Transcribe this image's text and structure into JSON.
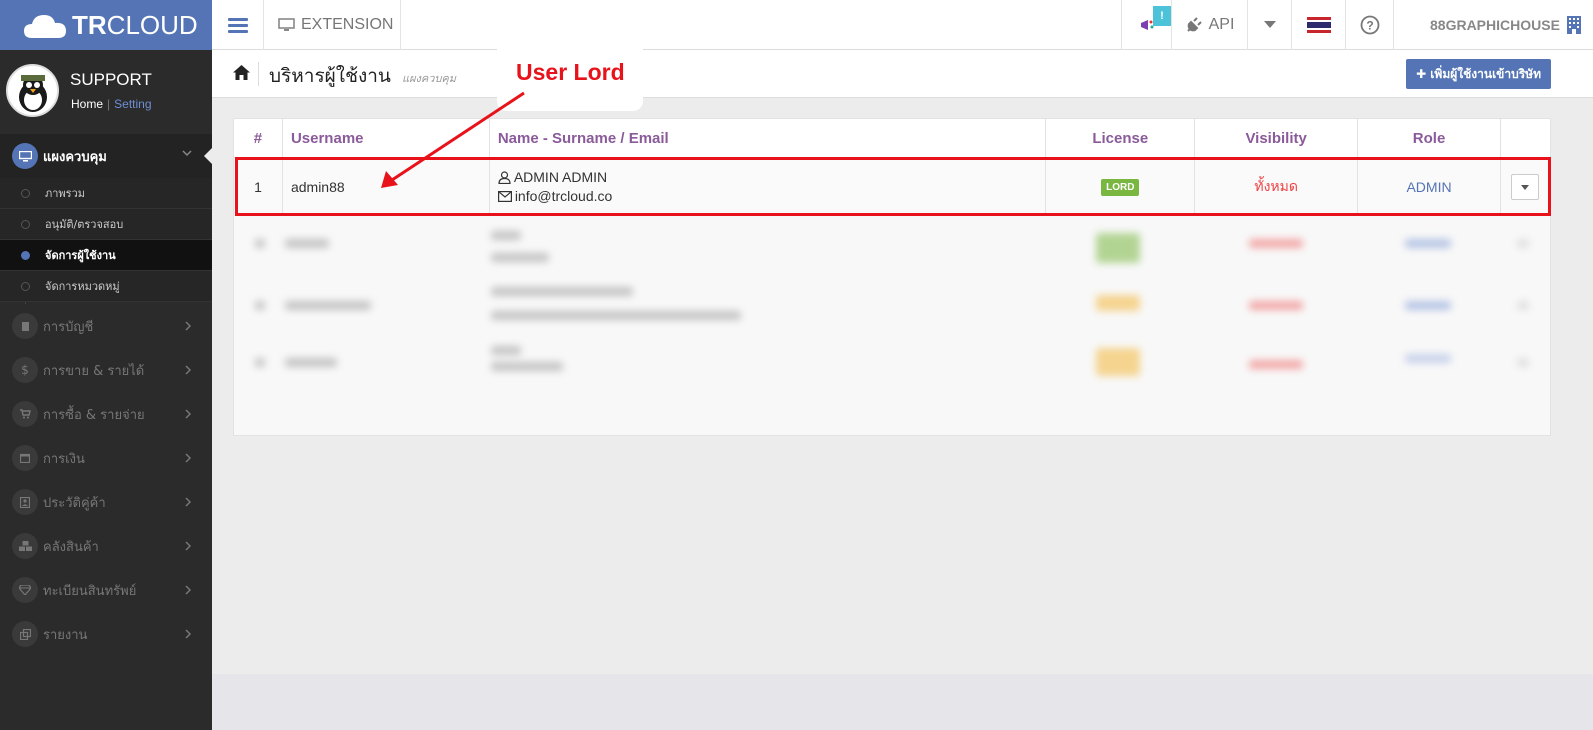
{
  "topbar": {
    "brand_bold": "TR",
    "brand_light": "CLOUD",
    "extension_label": "EXTENSION",
    "notification_badge": "!",
    "api_label": "API",
    "user_label": "88GRAPHICHOUSE",
    "icons": [
      "cloud-icon",
      "menu-icon",
      "monitor-icon",
      "megaphone-icon",
      "plug-icon",
      "caret-down-icon",
      "thai-flag-icon",
      "help-icon",
      "building-icon"
    ]
  },
  "sidebar": {
    "profile_name": "SUPPORT",
    "home_link": "Home",
    "setting_link": "Setting",
    "main_item": "แผงควบคุม",
    "sub_items": [
      "ภาพรวม",
      "อนุมัติ/ตรวจสอบ",
      "จัดการผู้ใช้งาน",
      "จัดการหมวดหมู่"
    ],
    "active_sub": "จัดการผู้ใช้งาน",
    "items": [
      {
        "label": "การบัญชี",
        "icon": "book-icon"
      },
      {
        "label": "การขาย & รายได้",
        "icon": "dollar-icon"
      },
      {
        "label": "การซื้อ & รายจ่าย",
        "icon": "cart-icon"
      },
      {
        "label": "การเงิน",
        "icon": "calendar-icon"
      },
      {
        "label": "ประวัติคู่ค้า",
        "icon": "contact-icon"
      },
      {
        "label": "คลังสินค้า",
        "icon": "cubes-icon"
      },
      {
        "label": "ทะเบียนสินทรัพย์",
        "icon": "diamond-icon"
      },
      {
        "label": "รายงาน",
        "icon": "report-icon"
      }
    ]
  },
  "header": {
    "title": "บริหารผู้ใช้งาน",
    "subtitle": "แผงควบคุม",
    "add_button": "✚ เพิ่มผู้ใช้งานเข้าบริษัท"
  },
  "annotation": {
    "label": "User Lord",
    "color": "#e8131a"
  },
  "table": {
    "headers": [
      "#",
      "Username",
      "Name - Surname / Email",
      "License",
      "Visibility",
      "Role"
    ],
    "rows": [
      {
        "num": "1",
        "username": "admin88",
        "name": "ADMIN ADMIN",
        "email": "info@trcloud.co",
        "license": "LORD",
        "visibility": "ทั้งหมด",
        "role": "ADMIN"
      }
    ]
  },
  "colors": {
    "brand": "#5474b6",
    "sidebar_bg": "#2b2b2b",
    "header_text": "#8a5a9a",
    "lord_badge": "#7ab741",
    "highlight": "#e8131a"
  }
}
